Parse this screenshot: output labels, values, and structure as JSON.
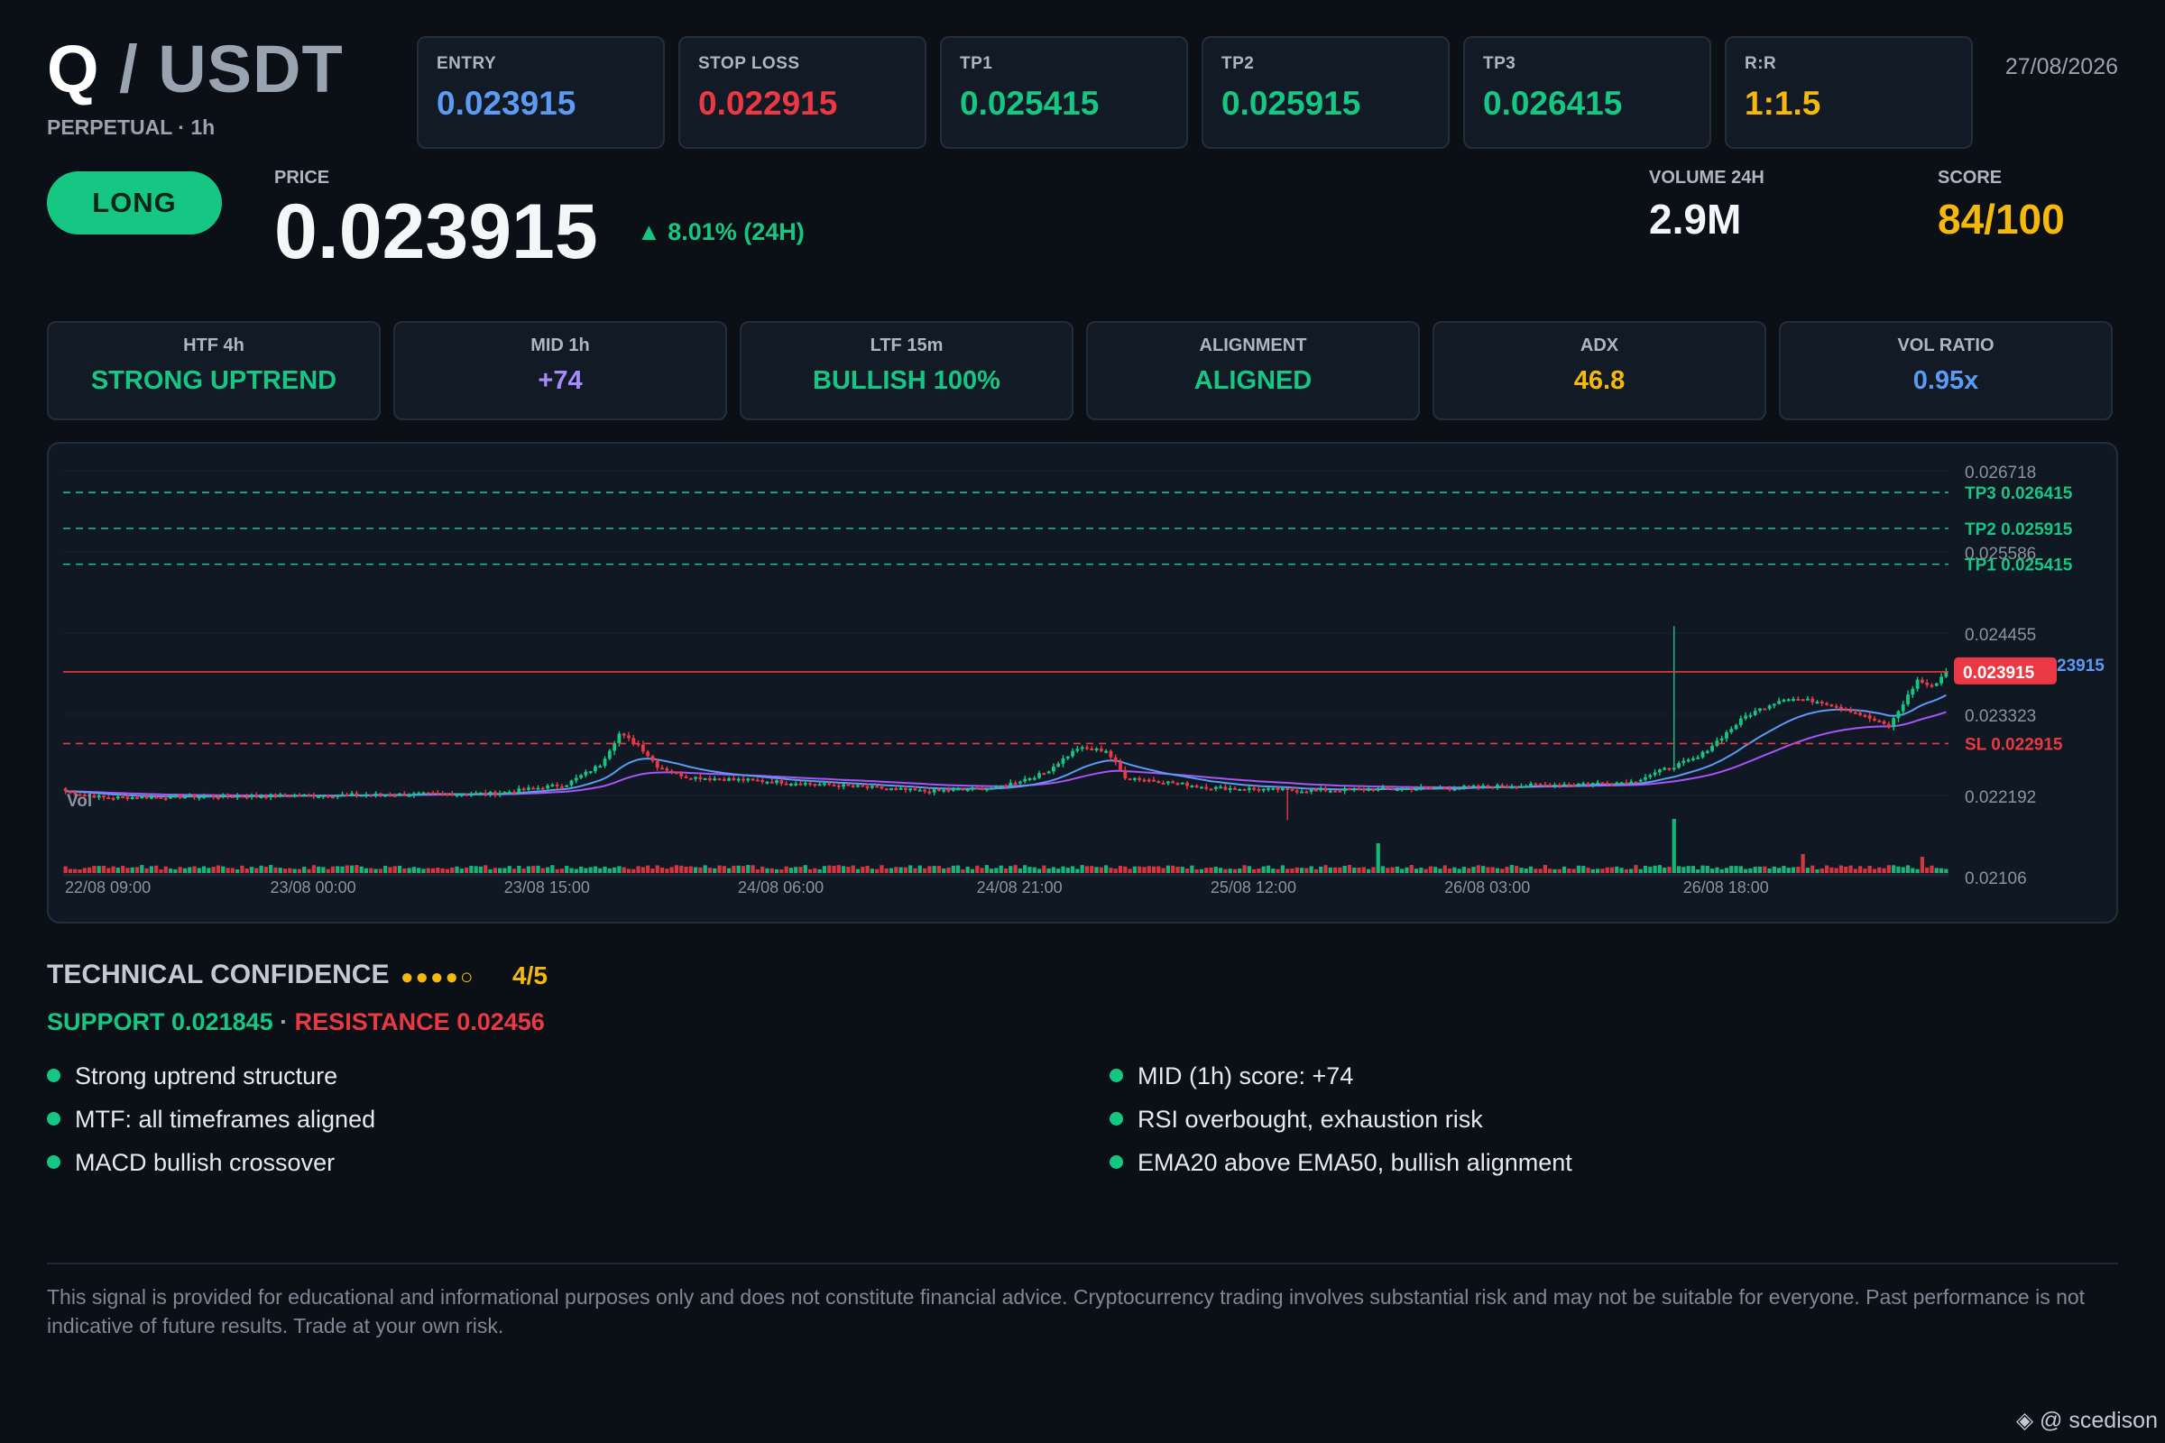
{
  "header": {
    "base": "Q",
    "quote": "/ USDT",
    "subtitle": "PERPETUAL · 1h",
    "date": "27/08/2026"
  },
  "levels": [
    {
      "label": "ENTRY",
      "value": "0.023915",
      "color": "#5b9bf3"
    },
    {
      "label": "STOP LOSS",
      "value": "0.022915",
      "color": "#ea3943"
    },
    {
      "label": "TP1",
      "value": "0.025415",
      "color": "#16c784"
    },
    {
      "label": "TP2",
      "value": "0.025915",
      "color": "#16c784"
    },
    {
      "label": "TP3",
      "value": "0.026415",
      "color": "#16c784"
    },
    {
      "label": "R:R",
      "value": "1:1.5",
      "color": "#f5b90b"
    }
  ],
  "signal": {
    "direction": "LONG",
    "price_label": "PRICE",
    "price": "0.023915",
    "change": "▲ 8.01% (24H)",
    "volume_label": "VOLUME 24H",
    "volume": "2.9M",
    "score_label": "SCORE",
    "score": "84/100"
  },
  "indicators": [
    {
      "label": "HTF 4h",
      "value": "STRONG UPTREND",
      "color": "#16c784"
    },
    {
      "label": "MID 1h",
      "value": "+74",
      "color": "#a78bfa"
    },
    {
      "label": "LTF 15m",
      "value": "BULLISH 100%",
      "color": "#16c784"
    },
    {
      "label": "ALIGNMENT",
      "value": "ALIGNED",
      "color": "#16c784"
    },
    {
      "label": "ADX",
      "value": "46.8",
      "color": "#f5b90b"
    },
    {
      "label": "VOL RATIO",
      "value": "0.95x",
      "color": "#5b9bf3"
    }
  ],
  "chart_data": {
    "type": "candlestick",
    "y_ticks": [
      "0.026718",
      "0.025586",
      "0.024455",
      "0.023323",
      "0.022192",
      "0.02106"
    ],
    "ylim": [
      0.02106,
      0.026718
    ],
    "x_ticks": [
      "22/08 09:00",
      "23/08 00:00",
      "23/08 15:00",
      "24/08 06:00",
      "24/08 21:00",
      "25/08 12:00",
      "26/08 03:00",
      "26/08 18:00"
    ],
    "volume_label": "Vol",
    "level_lines": [
      {
        "label": "TP3 0.026415",
        "value": 0.026415,
        "color": "#16c784",
        "style": "dashed"
      },
      {
        "label": "TP2 0.025915",
        "value": 0.025915,
        "color": "#16c784",
        "style": "dashed"
      },
      {
        "label": "TP1 0.025415",
        "value": 0.025415,
        "color": "#16c784",
        "style": "dashed"
      },
      {
        "label": "SL 0.022915",
        "value": 0.022915,
        "color": "#ea3943",
        "style": "dashed"
      },
      {
        "label": "0.023915",
        "value": 0.023915,
        "color": "#ea3943",
        "style": "solid"
      }
    ],
    "entry_marker": "23915",
    "candles_summary": "hourly candles 22/08 09:00 to 27/08, flat around 0.0222 with a rally near 24/08 and a breakout on 26/08 late to about 0.0239",
    "anchors": [
      [
        0,
        0.02225
      ],
      [
        8,
        0.02216
      ],
      [
        30,
        0.02218
      ],
      [
        60,
        0.0222
      ],
      [
        90,
        0.02222
      ],
      [
        105,
        0.02235
      ],
      [
        112,
        0.02262
      ],
      [
        116,
        0.02305
      ],
      [
        120,
        0.0229
      ],
      [
        124,
        0.0226
      ],
      [
        130,
        0.02245
      ],
      [
        150,
        0.02238
      ],
      [
        165,
        0.02232
      ],
      [
        180,
        0.02225
      ],
      [
        195,
        0.0223
      ],
      [
        205,
        0.0225
      ],
      [
        212,
        0.02285
      ],
      [
        218,
        0.02282
      ],
      [
        222,
        0.02245
      ],
      [
        240,
        0.0223
      ],
      [
        260,
        0.02226
      ],
      [
        290,
        0.0223
      ],
      [
        310,
        0.02234
      ],
      [
        328,
        0.02238
      ],
      [
        336,
        0.02258
      ],
      [
        342,
        0.02272
      ],
      [
        346,
        0.02295
      ],
      [
        352,
        0.0233
      ],
      [
        360,
        0.02355
      ],
      [
        368,
        0.0235
      ],
      [
        375,
        0.02335
      ],
      [
        382,
        0.02315
      ],
      [
        388,
        0.0238
      ],
      [
        391,
        0.0237
      ],
      [
        394,
        0.02392
      ]
    ],
    "volume_spike": [
      [
        275,
        0.55
      ],
      [
        337,
        1.0
      ],
      [
        364,
        0.35
      ],
      [
        389,
        0.3
      ]
    ]
  },
  "confidence": {
    "title": "TECHNICAL CONFIDENCE",
    "dots": "●●●●○",
    "score": "4/5",
    "support": "SUPPORT 0.021845",
    "sep": "·",
    "resistance": "RESISTANCE 0.02456"
  },
  "reasons": [
    "Strong uptrend structure",
    "MTF: all timeframes aligned",
    "MACD bullish crossover",
    "MID (1h) score: +74",
    "RSI overbought, exhaustion risk",
    "EMA20 above EMA50, bullish alignment"
  ],
  "disclaimer": "This signal is provided for educational and informational purposes only and does not constitute financial advice. Cryptocurrency trading involves substantial risk and may not be suitable for everyone. Past performance is not indicative of future results. Trade at your own risk.",
  "watermark": "@ scedison",
  "colors": {
    "up": "#16c784",
    "down": "#ea3943",
    "ema20": "#5b9bf3",
    "ema50": "#a855f7"
  }
}
